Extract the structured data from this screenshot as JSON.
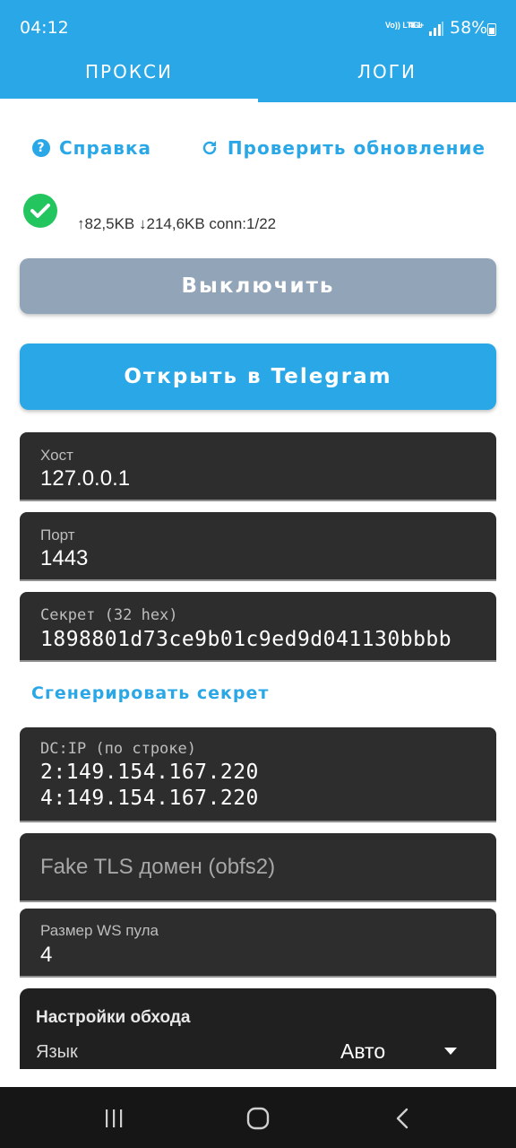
{
  "status_bar": {
    "time": "04:12",
    "volte": "Vo)) LTE1",
    "network": "4G+",
    "battery": "58%"
  },
  "tabs": [
    {
      "label": "ПРОКСИ",
      "active": true
    },
    {
      "label": "ЛОГИ",
      "active": false
    }
  ],
  "links": {
    "help": "Справка",
    "check_update": "Проверить обновление"
  },
  "status": {
    "stats": "↑82,5KB ↓214,6KB conn:1/22"
  },
  "buttons": {
    "disable": "Выключить",
    "open_telegram": "Открыть в Telegram"
  },
  "fields": {
    "host": {
      "label": "Хост",
      "value": "127.0.0.1"
    },
    "port": {
      "label": "Порт",
      "value": "1443"
    },
    "secret": {
      "label": "Секрет (32 hex)",
      "value": "1898801d73ce9b01c9ed9d041130bbbb"
    },
    "dc_ip": {
      "label": "DC:IP (по строке)",
      "line1": "2:149.154.167.220",
      "line2": "4:149.154.167.220"
    },
    "fake_tls": {
      "placeholder": "Fake TLS домен (obfs2)"
    },
    "ws_pool": {
      "label": "Размер WS пула",
      "value": "4"
    }
  },
  "generate_secret": "Сгенерировать секрет",
  "settings": {
    "title": "Настройки обхода",
    "language_label": "Язык",
    "language_value": "Авто"
  },
  "colors": {
    "accent": "#2aa7e6",
    "success": "#22c55e",
    "disabled_button": "#92a4b8",
    "field_bg": "#2d2d2d"
  }
}
